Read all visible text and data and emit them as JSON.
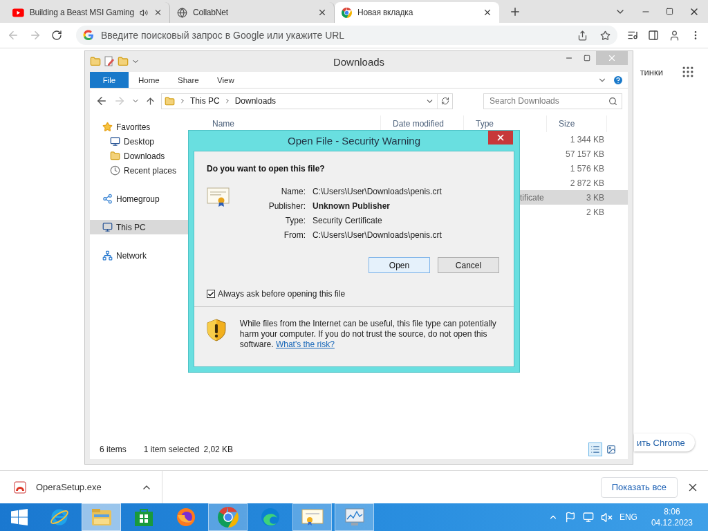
{
  "browser": {
    "tabs": [
      {
        "title": "Building a Beast MSI Gaming",
        "kind": "video",
        "audio": true,
        "selected": false
      },
      {
        "title": "CollabNet",
        "kind": "web",
        "audio": false,
        "selected": false
      },
      {
        "title": "Новая вкладка",
        "kind": "browser",
        "audio": false,
        "selected": true
      }
    ],
    "omnibox": {
      "placeholder": "Введите поисковый запрос в Google или укажите URL"
    }
  },
  "page": {
    "top_link": "тинки",
    "pill_button": "ить Chrome"
  },
  "explorer": {
    "title": "Downloads",
    "ribbon_tabs": [
      {
        "label": "File",
        "kind": "menu"
      },
      {
        "label": "Home",
        "kind": "tab"
      },
      {
        "label": "Share",
        "kind": "tab"
      },
      {
        "label": "View",
        "kind": "tab"
      }
    ],
    "breadcrumb": [
      "This PC",
      "Downloads"
    ],
    "search": {
      "placeholder": "Search Downloads"
    },
    "nav": [
      {
        "label": "Favorites",
        "kind": "star",
        "selected": false,
        "children": [
          {
            "label": "Desktop",
            "kind": "desktop",
            "selected": false
          },
          {
            "label": "Downloads",
            "kind": "folder",
            "selected": false
          },
          {
            "label": "Recent places",
            "kind": "recent",
            "selected": false
          }
        ]
      },
      {
        "label": "Homegroup",
        "kind": "homegroup",
        "selected": false
      },
      {
        "label": "This PC",
        "kind": "pc",
        "selected": true
      },
      {
        "label": "Network",
        "kind": "network",
        "selected": false
      }
    ],
    "columns": [
      "Name",
      "Date modified",
      "Type",
      "Size"
    ],
    "rows": [
      {
        "size": "1 344 KB",
        "selected": false
      },
      {
        "size": "57 157 KB",
        "selected": false
      },
      {
        "size": "1 576 KB",
        "selected": false
      },
      {
        "size": "2 872 KB",
        "selected": false
      },
      {
        "type": "tificate",
        "size": "3 KB",
        "selected": true
      },
      {
        "size": "2 KB",
        "selected": false
      }
    ],
    "status": {
      "count": "6 items",
      "selection": "1 item selected",
      "selection_size": "2,02 KB"
    },
    "views": [
      {
        "kind": "details",
        "selected": true
      },
      {
        "kind": "tiles",
        "selected": false
      }
    ]
  },
  "dialog": {
    "title": "Open File - Security Warning",
    "question": "Do you want to open this file?",
    "fields": [
      {
        "label": "Name:",
        "value": "C:\\Users\\User\\Downloads\\penis.crt",
        "bold": false
      },
      {
        "label": "Publisher:",
        "value": "Unknown Publisher",
        "bold": true
      },
      {
        "label": "Type:",
        "value": "Security Certificate",
        "bold": false
      },
      {
        "label": "From:",
        "value": "C:\\Users\\User\\Downloads\\penis.crt",
        "bold": false
      }
    ],
    "buttons": [
      {
        "label": "Open",
        "focused": true
      },
      {
        "label": "Cancel",
        "focused": false
      }
    ],
    "checkbox": {
      "label": "Always ask before opening this file",
      "checked": true
    },
    "warning": "While files from the Internet can be useful, this file type can potentially harm your computer. If you do not trust the source, do not open this software.",
    "link": "What's the risk?"
  },
  "downloads": {
    "file": "OperaSetup.exe",
    "show_all": "Показать все"
  },
  "taskbar": {
    "apps": [
      {
        "kind": "ie",
        "running": false,
        "active": false
      },
      {
        "kind": "explorer",
        "running": true,
        "active": true
      },
      {
        "kind": "store",
        "running": false,
        "active": false
      },
      {
        "kind": "firefox",
        "running": false,
        "active": false
      },
      {
        "kind": "chrome",
        "running": true,
        "active": false
      },
      {
        "kind": "edge",
        "running": false,
        "active": false
      },
      {
        "kind": "certificate",
        "running": true,
        "active": false
      },
      {
        "kind": "monitor",
        "running": true,
        "active": false
      }
    ],
    "volume_muted": true,
    "language": "ENG",
    "time": "8:06",
    "date": "04.12.2023"
  }
}
